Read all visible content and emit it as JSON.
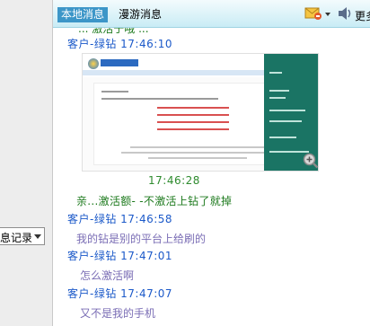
{
  "history_select": {
    "value": "息记录"
  },
  "tabs": [
    {
      "label": "本地消息",
      "active": true
    },
    {
      "label": "漫游消息",
      "active": false
    }
  ],
  "toolbar": {
    "mail_icon": "mail-icon",
    "speaker_icon": "speaker-icon",
    "more_label": "更多"
  },
  "messages": {
    "m0_partial": "... 激活于哦 ...",
    "m1_sender": "客户-绿钻 17:46:10",
    "m1_image_time": "17:46:28",
    "m2_text": "亲...激活额- -不激活上钻了就掉",
    "m3_sender": "客户-绿钻 17:46:58",
    "m3_text": "我的钻是别的平台上给刷的",
    "m4_sender": "客户-绿钻 17:47:01",
    "m4_text": "怎么激活啊",
    "m5_sender": "客户-绿钻 17:47:07",
    "m5_text": "又不是我的手机"
  },
  "colors": {
    "tab_active_bg": "#3c96c8",
    "sender": "#1b59c9",
    "agent_text": "#1d7a1d",
    "customer_text": "#7a6db5"
  }
}
